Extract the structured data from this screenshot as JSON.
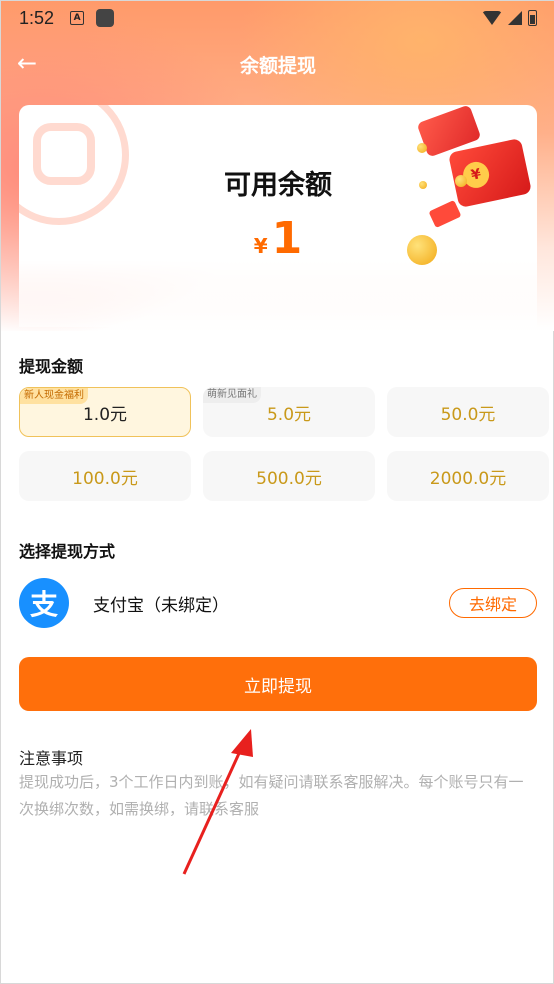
{
  "status_bar": {
    "time": "1:52",
    "app_icon_letter": "A"
  },
  "header": {
    "title": "余额提现"
  },
  "balance": {
    "label": "可用余额",
    "currency": "¥",
    "amount": "1"
  },
  "withdraw_amount": {
    "title": "提现金额",
    "options": [
      {
        "label": "1.0元",
        "tag": "新人现金福利",
        "selected": true
      },
      {
        "label": "5.0元",
        "tag": "萌新见面礼",
        "selected": false
      },
      {
        "label": "50.0元",
        "tag": "",
        "selected": false
      },
      {
        "label": "100.0元",
        "tag": "",
        "selected": false
      },
      {
        "label": "500.0元",
        "tag": "",
        "selected": false
      },
      {
        "label": "2000.0元",
        "tag": "",
        "selected": false
      }
    ]
  },
  "method": {
    "title": "选择提现方式",
    "alipay_icon_glyph": "支",
    "alipay_label": "支付宝（未绑定）",
    "unbind_label": "去绑定"
  },
  "submit": {
    "label": "立即提现"
  },
  "notes": {
    "title": "注意事项",
    "text": "提现成功后，3个工作日内到账，如有疑问请联系客服解决。每个账号只有一次换绑次数，如需换绑，请联系客服"
  },
  "colors": {
    "accent": "#ff6f0b",
    "amount_text": "#c9991a",
    "alipay_blue": "#1890ff",
    "annotation_arrow": "#e8201e"
  }
}
